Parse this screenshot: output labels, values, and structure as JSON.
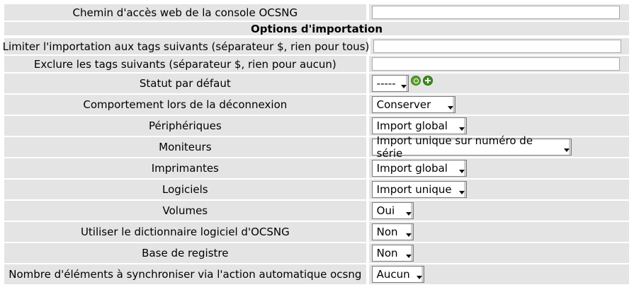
{
  "rows": {
    "web_path": {
      "label": "Chemin d'accès web de la console OCSNG",
      "value": ""
    },
    "section_title": "Options d'importation",
    "limit_tags": {
      "label": "Limiter l'importation aux tags suivants (séparateur $, rien pour tous)",
      "value": ""
    },
    "exclude_tags": {
      "label": "Exclure les tags suivants (séparateur $, rien pour aucun)",
      "value": ""
    },
    "default_status": {
      "label": "Statut par défaut",
      "value": "-----"
    },
    "disconnect_behavior": {
      "label": "Comportement lors de la déconnexion",
      "value": "Conserver"
    },
    "peripherals": {
      "label": "Périphériques",
      "value": "Import global"
    },
    "monitors": {
      "label": "Moniteurs",
      "value": "Import unique sur numéro de série"
    },
    "printers": {
      "label": "Imprimantes",
      "value": "Import global"
    },
    "software": {
      "label": "Logiciels",
      "value": "Import unique"
    },
    "volumes": {
      "label": "Volumes",
      "value": "Oui"
    },
    "software_dictionary": {
      "label": "Utiliser le dictionnaire logiciel d'OCSNG",
      "value": "Non"
    },
    "registry": {
      "label": "Base de registre",
      "value": "Non"
    },
    "sync_count": {
      "label": "Nombre d'éléments à synchroniser via l'action automatique ocsng",
      "value": "Aucun"
    }
  },
  "icons": [
    "search-icon",
    "add-icon"
  ],
  "colors": {
    "row_bg": "#e4e4e4",
    "icon_green": "#5aa02c"
  }
}
